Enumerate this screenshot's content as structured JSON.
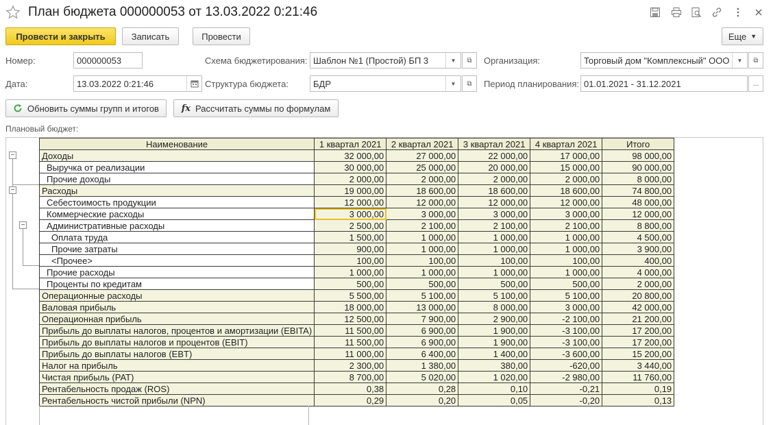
{
  "window": {
    "title": "План бюджета 000000053 от 13.03.2022 0:21:46"
  },
  "toolbar": {
    "post_close": "Провести и закрыть",
    "save": "Записать",
    "post": "Провести",
    "more": "Еще"
  },
  "form": {
    "number_label": "Номер:",
    "number_value": "000000053",
    "date_label": "Дата:",
    "date_value": "13.03.2022  0:21:46",
    "scheme_label": "Схема бюджетирования:",
    "scheme_value": "Шаблон №1 (Простой) БП 3",
    "structure_label": "Структура бюджета:",
    "structure_value": "БДР",
    "org_label": "Организация:",
    "org_value": "Торговый дом \"Комплексный\" ООО",
    "period_label": "Период планирования:",
    "period_value": "01.01.2021 - 31.12.2021"
  },
  "actions": {
    "refresh_totals": "Обновить суммы групп и итогов",
    "calc_formulas": "Рассчитать суммы по формулам"
  },
  "section_label": "Плановый бюджет:",
  "table": {
    "headers": [
      "Наименование",
      "1 квартал 2021",
      "2 квартал 2021",
      "3 квартал 2021",
      "4 квартал 2021",
      "Итого"
    ],
    "rows": [
      {
        "name": "Доходы",
        "indent": 0,
        "kind": "group",
        "values": [
          "32 000,00",
          "27 000,00",
          "22 000,00",
          "17 000,00",
          "98 000,00"
        ]
      },
      {
        "name": "Выручка от реализации",
        "indent": 1,
        "kind": "item",
        "values": [
          "30 000,00",
          "25 000,00",
          "20 000,00",
          "15 000,00",
          "90 000,00"
        ]
      },
      {
        "name": "Прочие доходы",
        "indent": 1,
        "kind": "item",
        "values": [
          "2 000,00",
          "2 000,00",
          "2 000,00",
          "2 000,00",
          "8 000,00"
        ]
      },
      {
        "name": "Расходы",
        "indent": 0,
        "kind": "group",
        "values": [
          "19 000,00",
          "18 600,00",
          "18 600,00",
          "18 600,00",
          "74 800,00"
        ]
      },
      {
        "name": "Себестоимость продукции",
        "indent": 1,
        "kind": "item",
        "values": [
          "12 000,00",
          "12 000,00",
          "12 000,00",
          "12 000,00",
          "48 000,00"
        ]
      },
      {
        "name": "Коммерческие расходы",
        "indent": 1,
        "kind": "item",
        "values": [
          "3 000,00",
          "3 000,00",
          "3 000,00",
          "3 000,00",
          "12 000,00"
        ]
      },
      {
        "name": "Административные расходы",
        "indent": 1,
        "kind": "item",
        "values": [
          "2 500,00",
          "2 100,00",
          "2 100,00",
          "2 100,00",
          "8 800,00"
        ]
      },
      {
        "name": "Оплата труда",
        "indent": 2,
        "kind": "item",
        "values": [
          "1 500,00",
          "1 000,00",
          "1 000,00",
          "1 000,00",
          "4 500,00"
        ]
      },
      {
        "name": "Прочие затраты",
        "indent": 2,
        "kind": "item",
        "values": [
          "900,00",
          "1 000,00",
          "1 000,00",
          "1 000,00",
          "3 900,00"
        ]
      },
      {
        "name": "<Прочее>",
        "indent": 2,
        "kind": "item",
        "values": [
          "100,00",
          "100,00",
          "100,00",
          "100,00",
          "400,00"
        ]
      },
      {
        "name": "Прочие расходы",
        "indent": 1,
        "kind": "item",
        "values": [
          "1 000,00",
          "1 000,00",
          "1 000,00",
          "1 000,00",
          "4 000,00"
        ]
      },
      {
        "name": "Проценты по кредитам",
        "indent": 1,
        "kind": "item",
        "values": [
          "500,00",
          "500,00",
          "500,00",
          "500,00",
          "2 000,00"
        ]
      },
      {
        "name": "Операционные расходы",
        "indent": 0,
        "kind": "calc",
        "values": [
          "5 500,00",
          "5 100,00",
          "5 100,00",
          "5 100,00",
          "20 800,00"
        ]
      },
      {
        "name": "Валовая прибыль",
        "indent": 0,
        "kind": "calc",
        "values": [
          "18 000,00",
          "13 000,00",
          "8 000,00",
          "3 000,00",
          "42 000,00"
        ]
      },
      {
        "name": "Операционная прибыль",
        "indent": 0,
        "kind": "calc",
        "values": [
          "12 500,00",
          "7 900,00",
          "2 900,00",
          "-2 100,00",
          "21 200,00"
        ]
      },
      {
        "name": "Прибыль до выплаты налогов, процентов и амортизации (EBITA)",
        "indent": 0,
        "kind": "calc",
        "values": [
          "11 500,00",
          "6 900,00",
          "1 900,00",
          "-3 100,00",
          "17 200,00"
        ]
      },
      {
        "name": "Прибыль до выплаты налогов и процентов (EBIT)",
        "indent": 0,
        "kind": "calc",
        "values": [
          "11 500,00",
          "6 900,00",
          "1 900,00",
          "-3 100,00",
          "17 200,00"
        ]
      },
      {
        "name": "Прибыль до выплаты налогов (EBT)",
        "indent": 0,
        "kind": "calc",
        "values": [
          "11 000,00",
          "6 400,00",
          "1 400,00",
          "-3 600,00",
          "15 200,00"
        ]
      },
      {
        "name": "Налог на прибыль",
        "indent": 0,
        "kind": "calc",
        "values": [
          "2 300,00",
          "1 380,00",
          "380,00",
          "-620,00",
          "3 440,00"
        ]
      },
      {
        "name": "Чистая прибыль (PAT)",
        "indent": 0,
        "kind": "calc",
        "values": [
          "8 700,00",
          "5 020,00",
          "1 020,00",
          "-2 980,00",
          "11 760,00"
        ]
      },
      {
        "name": "Рентабельность продаж (ROS)",
        "indent": 0,
        "kind": "calc",
        "values": [
          "0,38",
          "0,28",
          "0,10",
          "-0,21",
          "0,19"
        ]
      },
      {
        "name": "Рентабельность чистой прибыли (NPN)",
        "indent": 0,
        "kind": "calc",
        "values": [
          "0,29",
          "0,20",
          "0,05",
          "-0,20",
          "0,13"
        ]
      }
    ]
  },
  "colors": {
    "accent": "#f0cb1b",
    "cell_bg": "#f4f4de",
    "header_bg": "#efeed3",
    "selection": "#e6c12f"
  }
}
